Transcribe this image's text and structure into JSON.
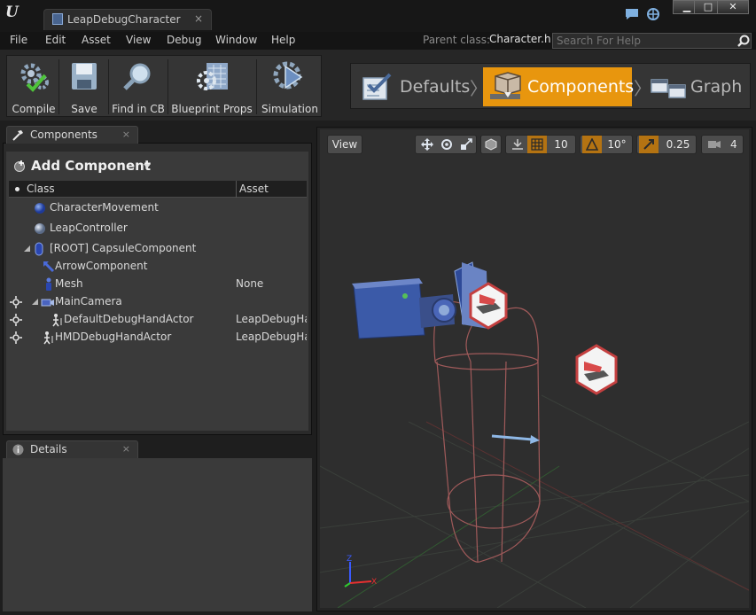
{
  "window": {
    "tab_title": "LeapDebugCharacter",
    "tab_close": "×",
    "minimize": "▁",
    "maximize": "□",
    "close": "✕"
  },
  "menu": {
    "items": [
      "File",
      "Edit",
      "Asset",
      "View",
      "Debug",
      "Window",
      "Help"
    ],
    "parent_class_label": "Parent class:",
    "parent_class_value": "Character.h",
    "search_placeholder": "Search For Help"
  },
  "toolbar": {
    "buttons": [
      "Compile",
      "Save",
      "Find in CB",
      "Blueprint Props",
      "Simulation"
    ]
  },
  "modes": {
    "items": [
      "Defaults",
      "Components",
      "Graph"
    ],
    "active": "Components",
    "separator": "〉"
  },
  "components_panel": {
    "tab_label": "Components",
    "tab_close": "×",
    "add_component_label": "Add Component",
    "columns": [
      "Class",
      "Asset"
    ],
    "rows": [
      {
        "name": "CharacterMovement",
        "asset": "",
        "icon": "sphere-blue-icon"
      },
      {
        "name": "LeapController",
        "asset": "",
        "icon": "sphere-grey-icon"
      },
      {
        "name": "[ROOT] CapsuleComponent",
        "asset": "",
        "icon": "capsule-icon"
      },
      {
        "name": "ArrowComponent",
        "asset": "",
        "icon": "arrow-component-icon"
      },
      {
        "name": "Mesh",
        "asset": "None",
        "icon": "mesh-figure-icon"
      },
      {
        "name": "MainCamera",
        "asset": "",
        "icon": "camera-icon"
      },
      {
        "name": "DefaultDebugHandActor",
        "asset": "LeapDebugHa",
        "icon": "actor-figure-icon"
      },
      {
        "name": "HMDDebugHandActor",
        "asset": "LeapDebugHa",
        "icon": "actor-figure-icon"
      }
    ]
  },
  "details_panel": {
    "tab_label": "Details",
    "tab_close": "×"
  },
  "viewport": {
    "view_label": "View",
    "grid_snap": "10",
    "rotation_snap": "10°",
    "scale_snap": "0.25",
    "camera_speed": "4",
    "axis_labels": [
      "Z",
      "X"
    ]
  },
  "colors": {
    "accent": "#e8960e",
    "capsule_wire": "#a05a5a",
    "arrow": "#8fb8e6"
  }
}
